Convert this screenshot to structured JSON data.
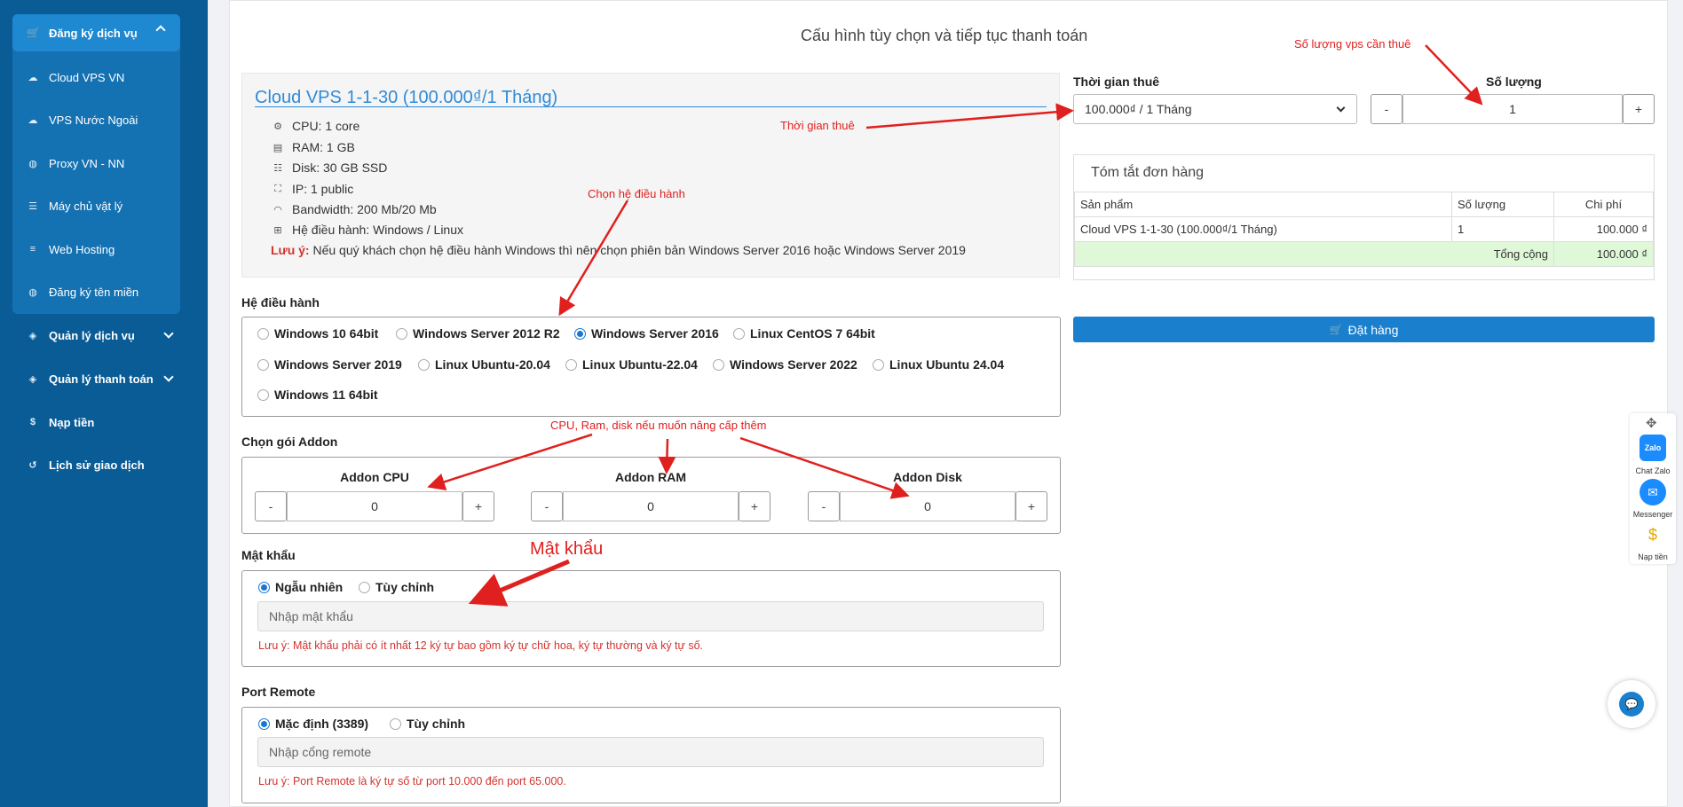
{
  "sidebar": {
    "group_title": "Đăng ký dịch vụ",
    "sub_items": [
      {
        "label": "Cloud VPS VN",
        "icon": "cloud-icon"
      },
      {
        "label": "VPS Nước Ngoài",
        "icon": "cloud-icon"
      },
      {
        "label": "Proxy VN - NN",
        "icon": "globe-icon"
      },
      {
        "label": "Máy chủ vật lý",
        "icon": "server-icon"
      },
      {
        "label": "Web Hosting",
        "icon": "database-icon"
      },
      {
        "label": "Đăng ký tên miền",
        "icon": "globe-icon"
      }
    ],
    "items": [
      {
        "label": "Quản lý dịch vụ",
        "icon": "layers-icon"
      },
      {
        "label": "Quản lý thanh toán",
        "icon": "layers-icon"
      },
      {
        "label": "Nạp tiền",
        "icon": "dollar-icon"
      },
      {
        "label": "Lịch sử giao dịch",
        "icon": "history-icon"
      }
    ]
  },
  "page": {
    "title": "Cấu hình tùy chọn và tiếp tục thanh toán"
  },
  "product": {
    "title": "Cloud VPS 1-1-30 (100.000₫/1 Tháng)",
    "specs": [
      {
        "text": "CPU: 1 core",
        "icon": "cpu-icon"
      },
      {
        "text": "RAM: 1 GB",
        "icon": "memory-icon"
      },
      {
        "text": "Disk: 30 GB SSD",
        "icon": "disk-icon"
      },
      {
        "text": "IP: 1 public",
        "icon": "network-icon"
      },
      {
        "text": "Bandwidth: 200 Mb/20 Mb",
        "icon": "wifi-icon"
      },
      {
        "text": "Hệ điều hành: Windows / Linux",
        "icon": "windows-icon"
      }
    ],
    "note_label": "Lưu ý:",
    "note_text": " Nếu quý khách chọn hệ điều hành Windows thì nên chọn phiên bản Windows Server 2016 hoặc Windows Server 2019"
  },
  "os": {
    "label": "Hệ điều hành",
    "options": [
      "Windows 10 64bit",
      "Windows Server 2012 R2",
      "Windows Server 2016",
      "Linux CentOS 7 64bit",
      "Windows Server 2019",
      "Linux Ubuntu-20.04",
      "Linux Ubuntu-22.04",
      "Windows Server 2022",
      "Linux Ubuntu 24.04",
      "Windows 11 64bit"
    ],
    "selected": "Windows Server 2016"
  },
  "addon": {
    "label": "Chọn gói Addon",
    "items": [
      {
        "label": "Addon CPU",
        "value": "0"
      },
      {
        "label": "Addon RAM",
        "value": "0"
      },
      {
        "label": "Addon Disk",
        "value": "0"
      }
    ],
    "minus": "-",
    "plus": "+"
  },
  "password": {
    "label": "Mật khẩu",
    "option_random": "Ngẫu nhiên",
    "option_custom": "Tùy chỉnh",
    "selected": "Ngẫu nhiên",
    "placeholder": "Nhập mật khẩu",
    "warning": "Lưu ý: Mật khẩu phải có ít nhất 12 ký tự bao gồm ký tự chữ hoa, ký tự thường và ký tự số."
  },
  "port": {
    "label": "Port Remote",
    "option_default": "Mặc định (3389)",
    "option_custom": "Tùy chỉnh",
    "selected": "Mặc định (3389)",
    "placeholder": "Nhập cổng remote",
    "warning": "Lưu ý: Port Remote là ký tự số từ port 10.000 đến port 65.000."
  },
  "rental": {
    "label": "Thời gian thuê",
    "selected": "100.000₫ / 1 Tháng"
  },
  "quantity": {
    "label": "Số lượng",
    "value": "1",
    "minus": "-",
    "plus": "+"
  },
  "summary": {
    "title": "Tóm tắt đơn hàng",
    "headers": [
      "Sản phẩm",
      "Số lượng",
      "Chi phí"
    ],
    "rows": [
      {
        "product": "Cloud VPS 1-1-30 (100.000₫/1 Tháng)",
        "qty": "1",
        "cost": "100.000 ₫"
      }
    ],
    "total_label": "Tổng cộng",
    "total_value": "100.000 ₫"
  },
  "order_button": "Đặt hàng",
  "annotations": {
    "qty_note": "Số lượng vps cần thuê",
    "rental_note": "Thời gian thuê",
    "os_note": "Chọn hệ điều hành",
    "addon_note": "CPU, Ram, disk nếu muốn nâng cấp thêm",
    "password_note": "Mật khẩu"
  },
  "float_widgets": {
    "zalo_icon_text": "Zalo",
    "zalo_label": "Chat Zalo",
    "messenger_label": "Messenger",
    "topup_label": "Nạp tiền"
  },
  "colors": {
    "sidebar": "#0a5c96",
    "accent": "#1a7fcd",
    "link": "#2e8ad8",
    "warning": "#d3332e",
    "total_row": "#dff8d8"
  }
}
